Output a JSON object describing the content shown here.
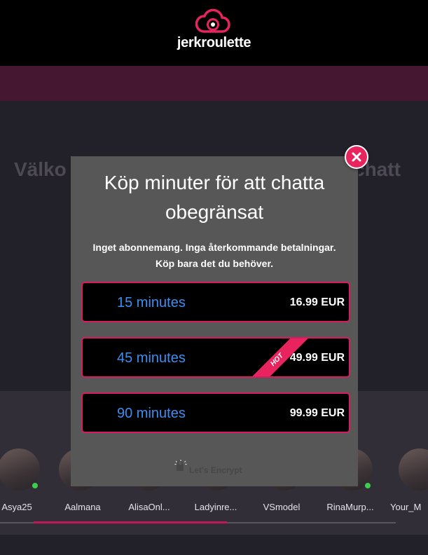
{
  "header": {
    "logo_text": "jerkroulette",
    "logo_icon": "webcam-cloud-icon",
    "accent_color": "#e8245e"
  },
  "background": {
    "welcome_left": "Välko",
    "welcome_right": "chatt"
  },
  "models": [
    {
      "name": "Asya25",
      "online": true
    },
    {
      "name": "Aalmana",
      "online": false
    },
    {
      "name": "AlisaOnl...",
      "online": true
    },
    {
      "name": "Ladyinre...",
      "online": false
    },
    {
      "name": "VSmodel",
      "online": false
    },
    {
      "name": "RinaMurp...",
      "online": true
    },
    {
      "name": "Your_M",
      "online": false
    }
  ],
  "modal": {
    "title": "Köp minuter för att chatta obegränsat",
    "subtitle_line1": "Inget abonnemang. Inga återkommande betalningar.",
    "subtitle_line2": "Köp bara det du behöver.",
    "close_icon": "close-icon",
    "plans": [
      {
        "duration": "15 minutes",
        "price": "16.99 EUR",
        "hot": false
      },
      {
        "duration": "45 minutes",
        "price": "49.99 EUR",
        "hot": true,
        "badge": "HOT"
      },
      {
        "duration": "90 minutes",
        "price": "99.99 EUR",
        "hot": false
      }
    ],
    "secure_label": "Let's Encrypt",
    "secure_icon": "lets-encrypt-icon"
  }
}
